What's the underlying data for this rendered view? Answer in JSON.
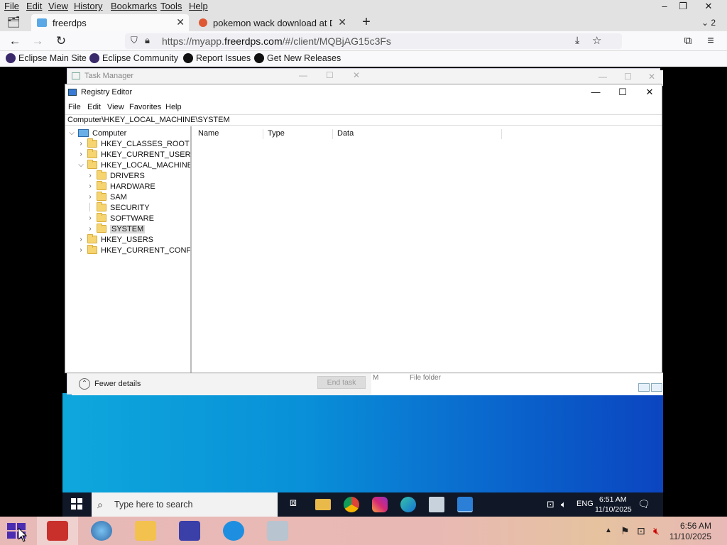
{
  "browser": {
    "menu": [
      "File",
      "Edit",
      "View",
      "History",
      "Bookmarks",
      "Tools",
      "Help"
    ],
    "window_controls": {
      "minimize": "–",
      "restore": "❐",
      "close": "✕"
    },
    "tabs": [
      {
        "label": "freerdps",
        "active": true
      },
      {
        "label": "pokemon wack download at Du",
        "active": false
      }
    ],
    "new_tab_label": "+",
    "tab_overflow_count": "2",
    "url_prefix": "https://myapp.",
    "url_domain": "freerdps.com",
    "url_rest": "/#/client/MQBjAG15c3Fs",
    "bookmarks": [
      "Eclipse Main Site",
      "Eclipse Community",
      "Report Issues",
      "Get New Releases"
    ]
  },
  "task_manager": {
    "title": "Task Manager",
    "fewer_details": "Fewer details",
    "end_task": "End task",
    "partial_col_a": "M",
    "partial_col_b": "File folder"
  },
  "registry_editor": {
    "title": "Registry Editor",
    "menu": [
      "File",
      "Edit",
      "View",
      "Favorites",
      "Help"
    ],
    "address": "Computer\\HKEY_LOCAL_MACHINE\\SYSTEM",
    "tree": [
      {
        "label": "Computer",
        "level": 0,
        "expanded": true,
        "type": "computer"
      },
      {
        "label": "HKEY_CLASSES_ROOT",
        "level": 1,
        "expanded": false
      },
      {
        "label": "HKEY_CURRENT_USER",
        "level": 1,
        "expanded": false
      },
      {
        "label": "HKEY_LOCAL_MACHINE",
        "level": 1,
        "expanded": true
      },
      {
        "label": "DRIVERS",
        "level": 2,
        "expanded": false
      },
      {
        "label": "HARDWARE",
        "level": 2,
        "expanded": false
      },
      {
        "label": "SAM",
        "level": 2,
        "expanded": false
      },
      {
        "label": "SECURITY",
        "level": 2,
        "expanded": false,
        "no_children": true
      },
      {
        "label": "SOFTWARE",
        "level": 2,
        "expanded": false
      },
      {
        "label": "SYSTEM",
        "level": 2,
        "expanded": false,
        "selected": true
      },
      {
        "label": "HKEY_USERS",
        "level": 1,
        "expanded": false
      },
      {
        "label": "HKEY_CURRENT_CONFIG",
        "level": 1,
        "expanded": false
      }
    ],
    "columns": [
      "Name",
      "Type",
      "Data"
    ]
  },
  "remote_taskbar": {
    "search_placeholder": "Type here to search",
    "apps": [
      "task-view",
      "file-explorer",
      "chrome",
      "instagram",
      "edge",
      "remote-desktop",
      "vscode"
    ],
    "lang": "ENG",
    "time": "6:51 AM",
    "date": "11/10/2025"
  },
  "host_taskbar": {
    "apps": [
      "app-red",
      "globe",
      "file-manager",
      "calendar",
      "internet-explorer",
      "screenshot-tool"
    ],
    "time": "6:56 AM",
    "date": "11/10/2025"
  },
  "colors": {
    "desktop_start": "#0ea7dc",
    "desktop_end": "#0b45c0",
    "host_taskbar": "#e7b9b7",
    "remote_taskbar": "#101828",
    "folder_yellow": "#f6d470"
  }
}
